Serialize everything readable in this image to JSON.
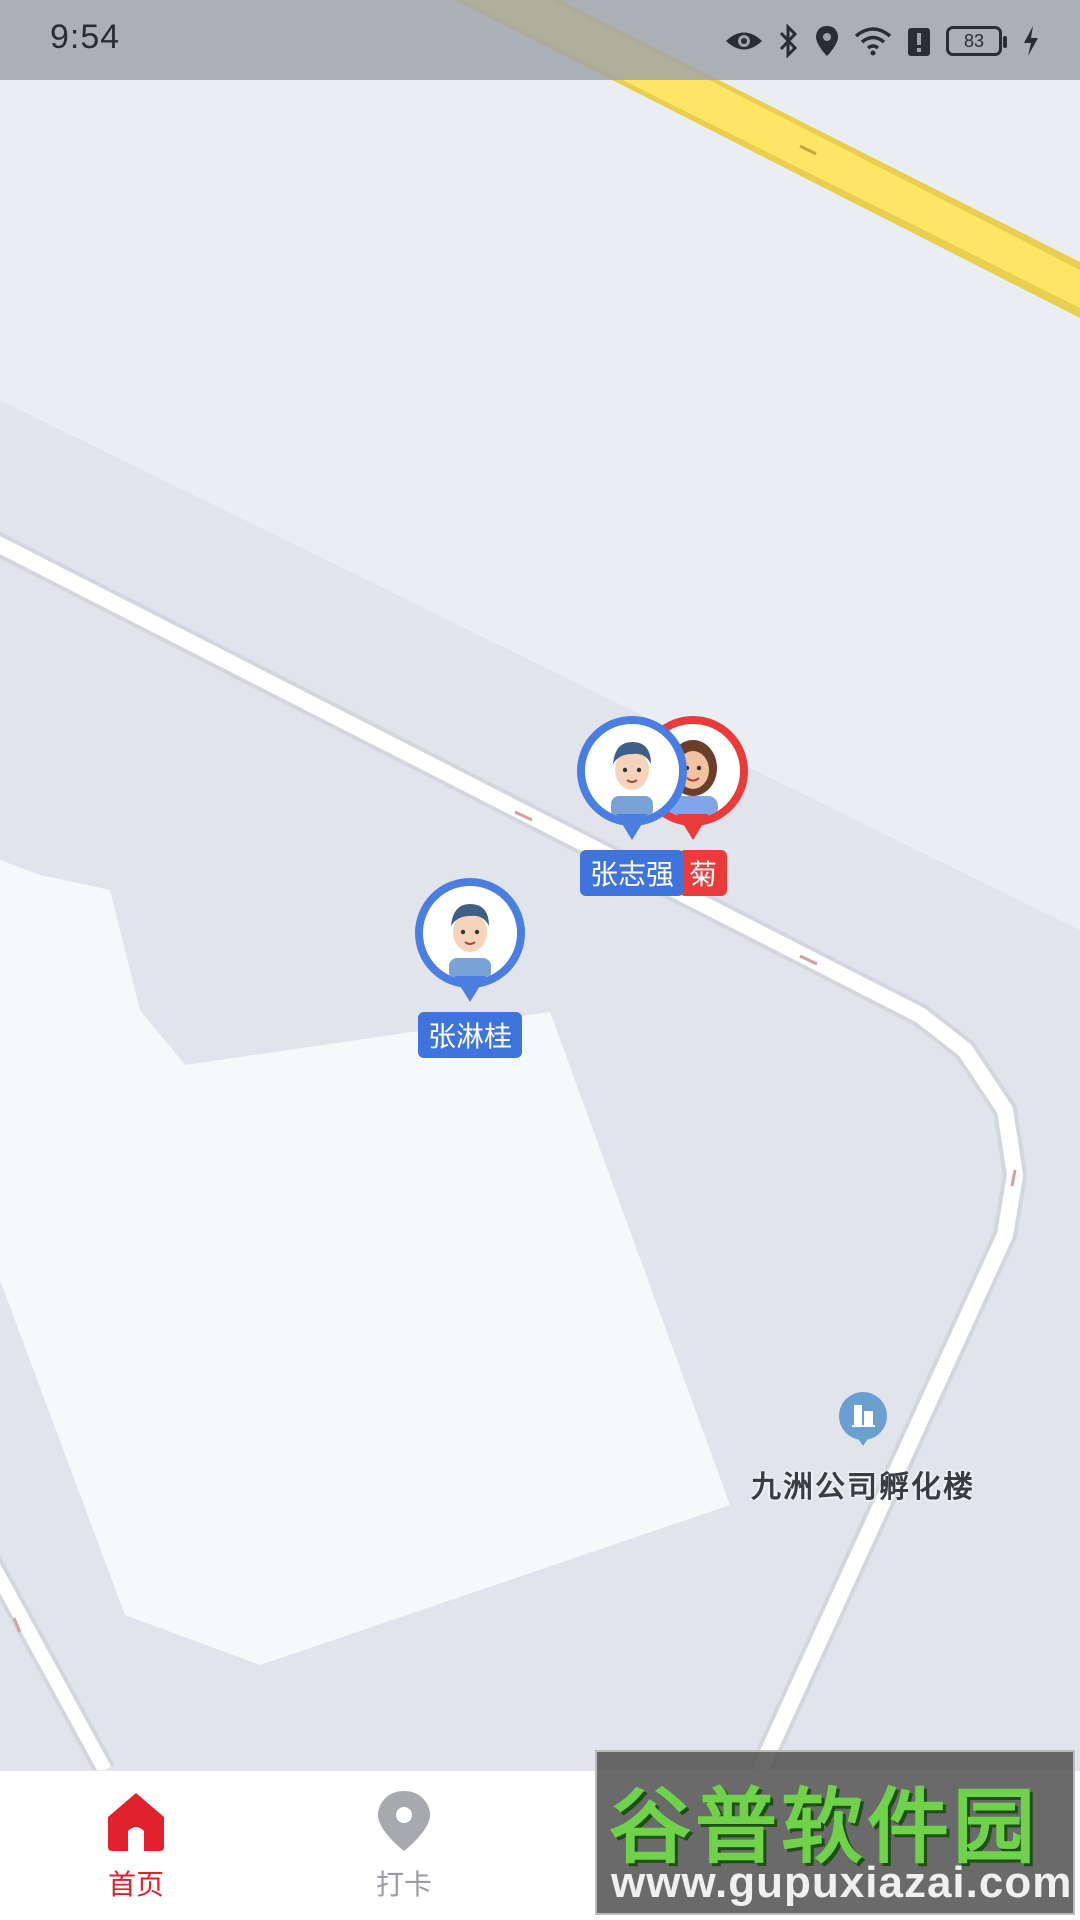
{
  "status_bar": {
    "time": "9:54",
    "battery": "83",
    "icons": [
      "eye-icon",
      "bluetooth-icon",
      "location-icon",
      "wifi-icon",
      "alert-icon",
      "battery-icon",
      "charging-icon"
    ]
  },
  "map": {
    "markers": [
      {
        "name": "张志强",
        "color": "#4a7ee0",
        "avatar": "male-avatar"
      },
      {
        "name": "菊",
        "color": "#ea3a3a",
        "avatar": "female-avatar"
      },
      {
        "name": "张淋桂",
        "color": "#4a7ee0",
        "avatar": "male-avatar"
      }
    ],
    "poi": {
      "label": "九洲公司孵化楼",
      "icon": "building-icon"
    }
  },
  "nav": {
    "items": [
      {
        "label": "首页",
        "icon": "home-icon",
        "active": true
      },
      {
        "label": "打卡",
        "icon": "location-pin-icon",
        "active": false
      }
    ]
  },
  "watermark": {
    "title": "谷普软件园",
    "url": "www.gupuxiazai.com"
  },
  "colors": {
    "accent": "#e0222c",
    "marker_blue": "#4a7ee0",
    "marker_red": "#ea3a3a",
    "road_yellow": "#ffe566"
  }
}
